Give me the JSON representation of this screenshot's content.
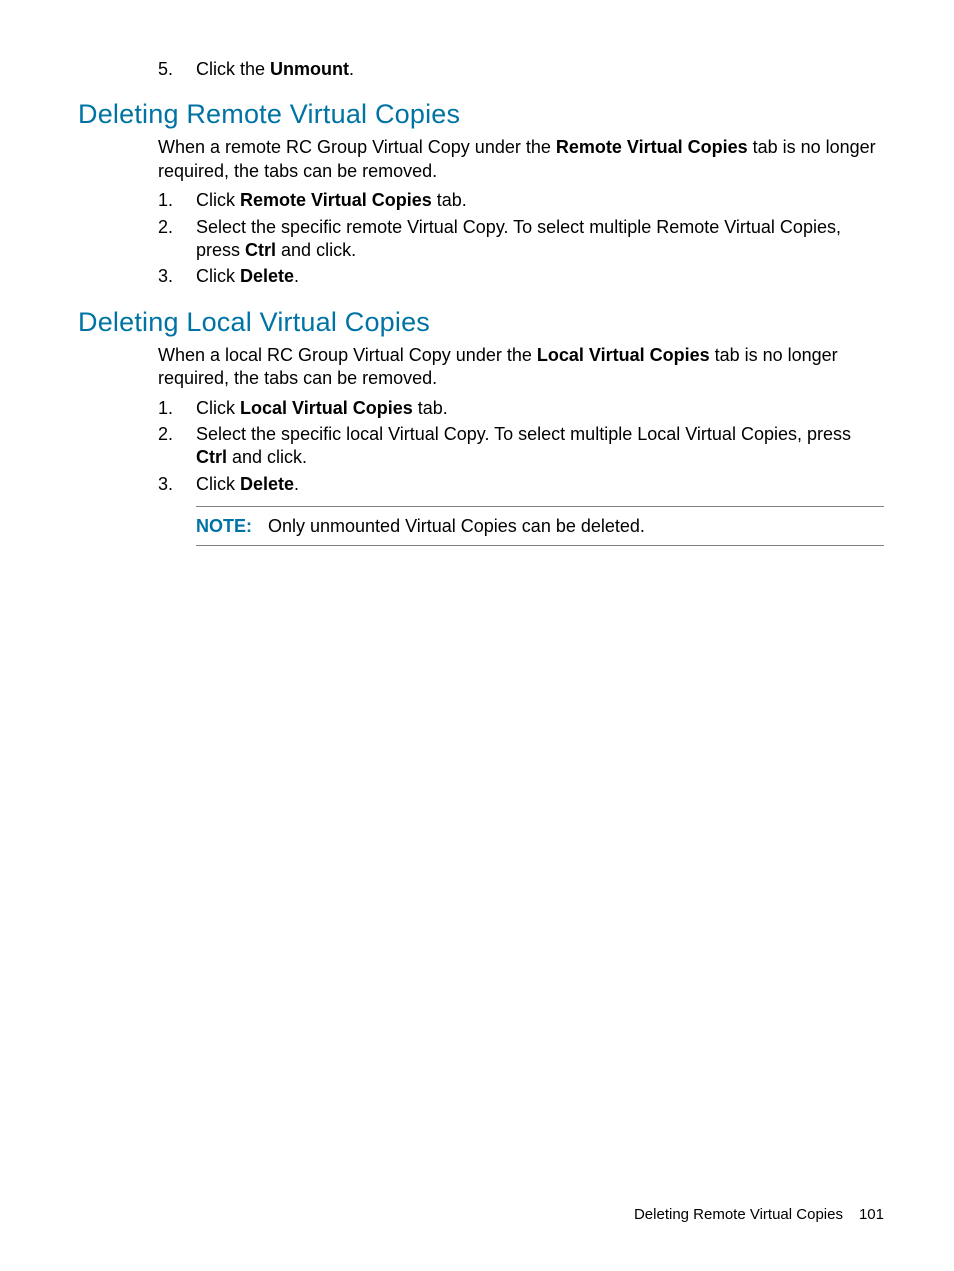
{
  "topStep": {
    "number": "5.",
    "pre": "Click the ",
    "bold": "Unmount",
    "post": "."
  },
  "section1": {
    "heading": "Deleting Remote Virtual Copies",
    "intro_pre": "When a remote RC Group Virtual Copy under the ",
    "intro_bold": "Remote Virtual Copies",
    "intro_post": " tab is no longer required, the tabs can be removed.",
    "steps": [
      {
        "pre": "Click ",
        "bold": "Remote Virtual Copies",
        "post": " tab."
      },
      {
        "pre": "Select the specific remote Virtual Copy. To select multiple Remote Virtual Copies, press ",
        "bold": "Ctrl",
        "post": " and click."
      },
      {
        "pre": "Click ",
        "bold": "Delete",
        "post": "."
      }
    ]
  },
  "section2": {
    "heading": "Deleting Local Virtual Copies",
    "intro_pre": "When a local RC Group Virtual Copy under the ",
    "intro_bold": "Local Virtual Copies",
    "intro_post": " tab is no longer required, the tabs can be removed.",
    "steps": [
      {
        "pre": "Click ",
        "bold": "Local Virtual Copies",
        "post": " tab."
      },
      {
        "pre": "Select the specific local Virtual Copy. To select multiple Local Virtual Copies, press ",
        "bold": "Ctrl",
        "post": " and click."
      },
      {
        "pre": "Click ",
        "bold": "Delete",
        "post": "."
      }
    ],
    "note_label": "NOTE:",
    "note_text": "Only unmounted Virtual Copies can be deleted."
  },
  "footer": {
    "text": "Deleting Remote Virtual Copies",
    "page": "101"
  }
}
